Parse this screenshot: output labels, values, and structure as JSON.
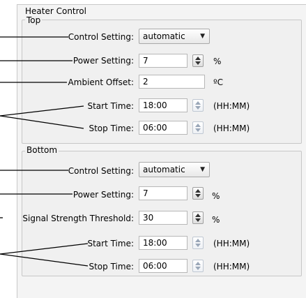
{
  "window": {
    "title": "Heater Control"
  },
  "top": {
    "title": "Top",
    "control_setting": {
      "label": "Control Setting:",
      "value": "automatic"
    },
    "power_setting": {
      "label": "Power Setting:",
      "value": "7",
      "unit": "%"
    },
    "ambient_offset": {
      "label": "Ambient Offset:",
      "value": "2",
      "unit": "ºC"
    },
    "start_time": {
      "label": "Start Time:",
      "value": "18:00",
      "unit": "(HH:MM)"
    },
    "stop_time": {
      "label": "Stop Time:",
      "value": "06:00",
      "unit": "(HH:MM)"
    }
  },
  "bottom": {
    "title": "Bottom",
    "control_setting": {
      "label": "Control Setting:",
      "value": "automatic"
    },
    "power_setting": {
      "label": "Power Setting:",
      "value": "7",
      "unit": "%"
    },
    "signal_threshold": {
      "label": "Signal Strength Threshold:",
      "value": "30",
      "unit": "%"
    },
    "start_time": {
      "label": "Start Time:",
      "value": "18:00",
      "unit": "(HH:MM)"
    },
    "stop_time": {
      "label": "Stop Time:",
      "value": "06:00",
      "unit": "(HH:MM)"
    }
  },
  "icons": {
    "dropdown": "chevron-down-icon",
    "spinner": "spinner-arrows-icon"
  }
}
